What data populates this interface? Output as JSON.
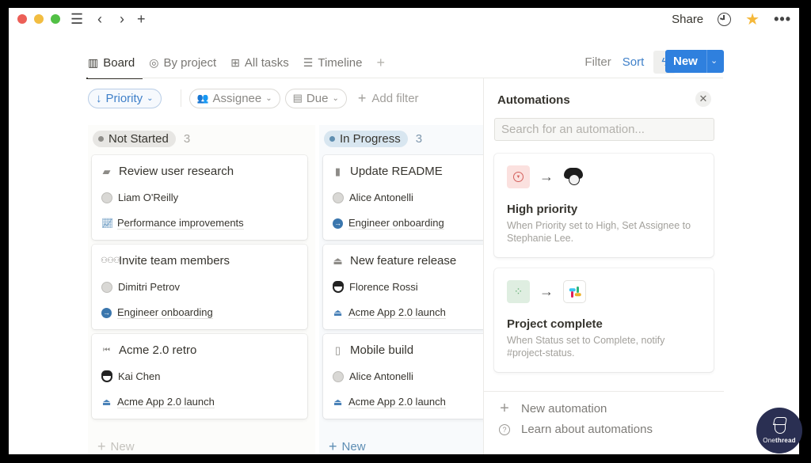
{
  "titlebar": {
    "share_label": "Share",
    "icons": [
      "menu-icon",
      "back-icon",
      "forward-icon",
      "add-icon",
      "clock-icon",
      "star-icon",
      "more-icon"
    ]
  },
  "tabs": [
    {
      "label": "Board",
      "icon": "board-icon",
      "active": true
    },
    {
      "label": "By project",
      "icon": "target-icon",
      "active": false
    },
    {
      "label": "All tasks",
      "icon": "table-icon",
      "active": false
    },
    {
      "label": "Timeline",
      "icon": "timeline-icon",
      "active": false
    }
  ],
  "toolbar": {
    "filter_label": "Filter",
    "sort_label": "Sort",
    "new_label": "New",
    "accent_color": "#2f80de"
  },
  "filters": {
    "priority_label": "Priority",
    "assignee_label": "Assignee",
    "due_label": "Due",
    "add_filter_label": "Add filter"
  },
  "board": {
    "columns": [
      {
        "status": "Not Started",
        "count": "3",
        "new_label": "New",
        "cards": [
          {
            "title": "Review user research",
            "icon": "clipboard-icon",
            "assignee": "Liam O'Reilly",
            "project": "Performance improvements",
            "project_icon": "chart-icon"
          },
          {
            "title": "Invite team members",
            "icon": "people-icon",
            "assignee": "Dimitri Petrov",
            "project": "Engineer onboarding",
            "project_icon": "arrow-circle-icon"
          },
          {
            "title": "Acme 2.0 retro",
            "icon": "rewind-icon",
            "assignee": "Kai Chen",
            "project": "Acme App 2.0 launch",
            "project_icon": "rocket-icon"
          }
        ]
      },
      {
        "status": "In Progress",
        "count": "3",
        "new_label": "New",
        "cards": [
          {
            "title": "Update README",
            "icon": "note-icon",
            "assignee": "Alice Antonelli",
            "project": "Engineer onboarding",
            "project_icon": "arrow-circle-icon"
          },
          {
            "title": "New feature release",
            "icon": "rocket-icon",
            "assignee": "Florence Rossi",
            "project": "Acme App 2.0 launch",
            "project_icon": "rocket-icon"
          },
          {
            "title": "Mobile build",
            "icon": "phone-icon",
            "assignee": "Alice Antonelli",
            "project": "Acme App 2.0 launch",
            "project_icon": "rocket-icon"
          }
        ]
      }
    ]
  },
  "automations": {
    "title": "Automations",
    "search_placeholder": "Search for an automation...",
    "items": [
      {
        "name": "High priority",
        "description": "When Priority set to High, Set Assignee to Stephanie Lee."
      },
      {
        "name": "Project complete",
        "description": "When Status set to Complete, notify #project-status."
      }
    ],
    "new_label": "New automation",
    "learn_label": "Learn about automations"
  },
  "watermark": {
    "text_light": "One",
    "text_bold": "thread"
  }
}
